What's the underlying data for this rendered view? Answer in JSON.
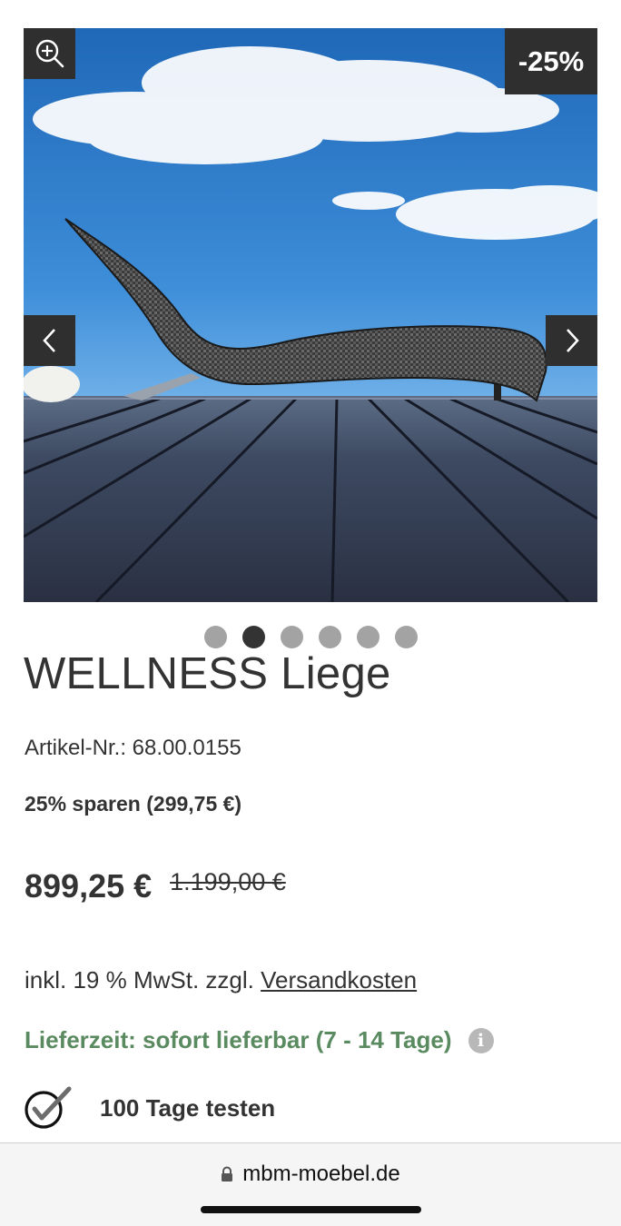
{
  "gallery": {
    "badge": "-25%",
    "slide_count": 6,
    "active_slide": 2
  },
  "product": {
    "title": "WELLNESS Liege",
    "sku": "Artikel-Nr.: 68.00.0155",
    "savings": "25% sparen (299,75 €)",
    "price": "899,25 €",
    "old_price": "1.199,00 €",
    "tax_prefix": "inkl. 19 % MwSt. zzgl.",
    "tax_link": "Versandkosten",
    "delivery": "Lieferzeit: sofort lieferbar (7 - 14 Tage)",
    "trial": "100 Tage testen"
  },
  "browser": {
    "url": "mbm-moebel.de"
  },
  "icons": {
    "zoom": "zoom-in-icon",
    "prev": "chevron-left-icon",
    "next": "chevron-right-icon",
    "info": "info-icon",
    "check": "check-circle-icon",
    "lock": "lock-icon"
  },
  "colors": {
    "dark": "#2f2f2f",
    "text": "#333333",
    "delivery_green": "#5a8a60",
    "dot_inactive": "#a3a3a3"
  }
}
